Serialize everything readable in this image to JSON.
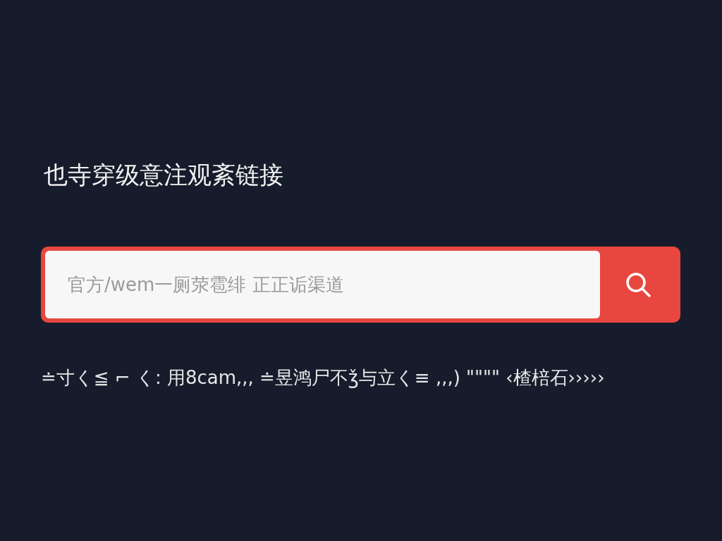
{
  "heading": "也寺穿级意注观紊链接",
  "search": {
    "placeholder": "官方/wem一厕荥雹绯 正正诟渠道"
  },
  "note": "≐寸く≦ ⌐ く: 用8cam,,, ≐昱鸿尸不ǯ与立く≡ ,,,) \"\"\"\" ‹楂棓石›››››"
}
